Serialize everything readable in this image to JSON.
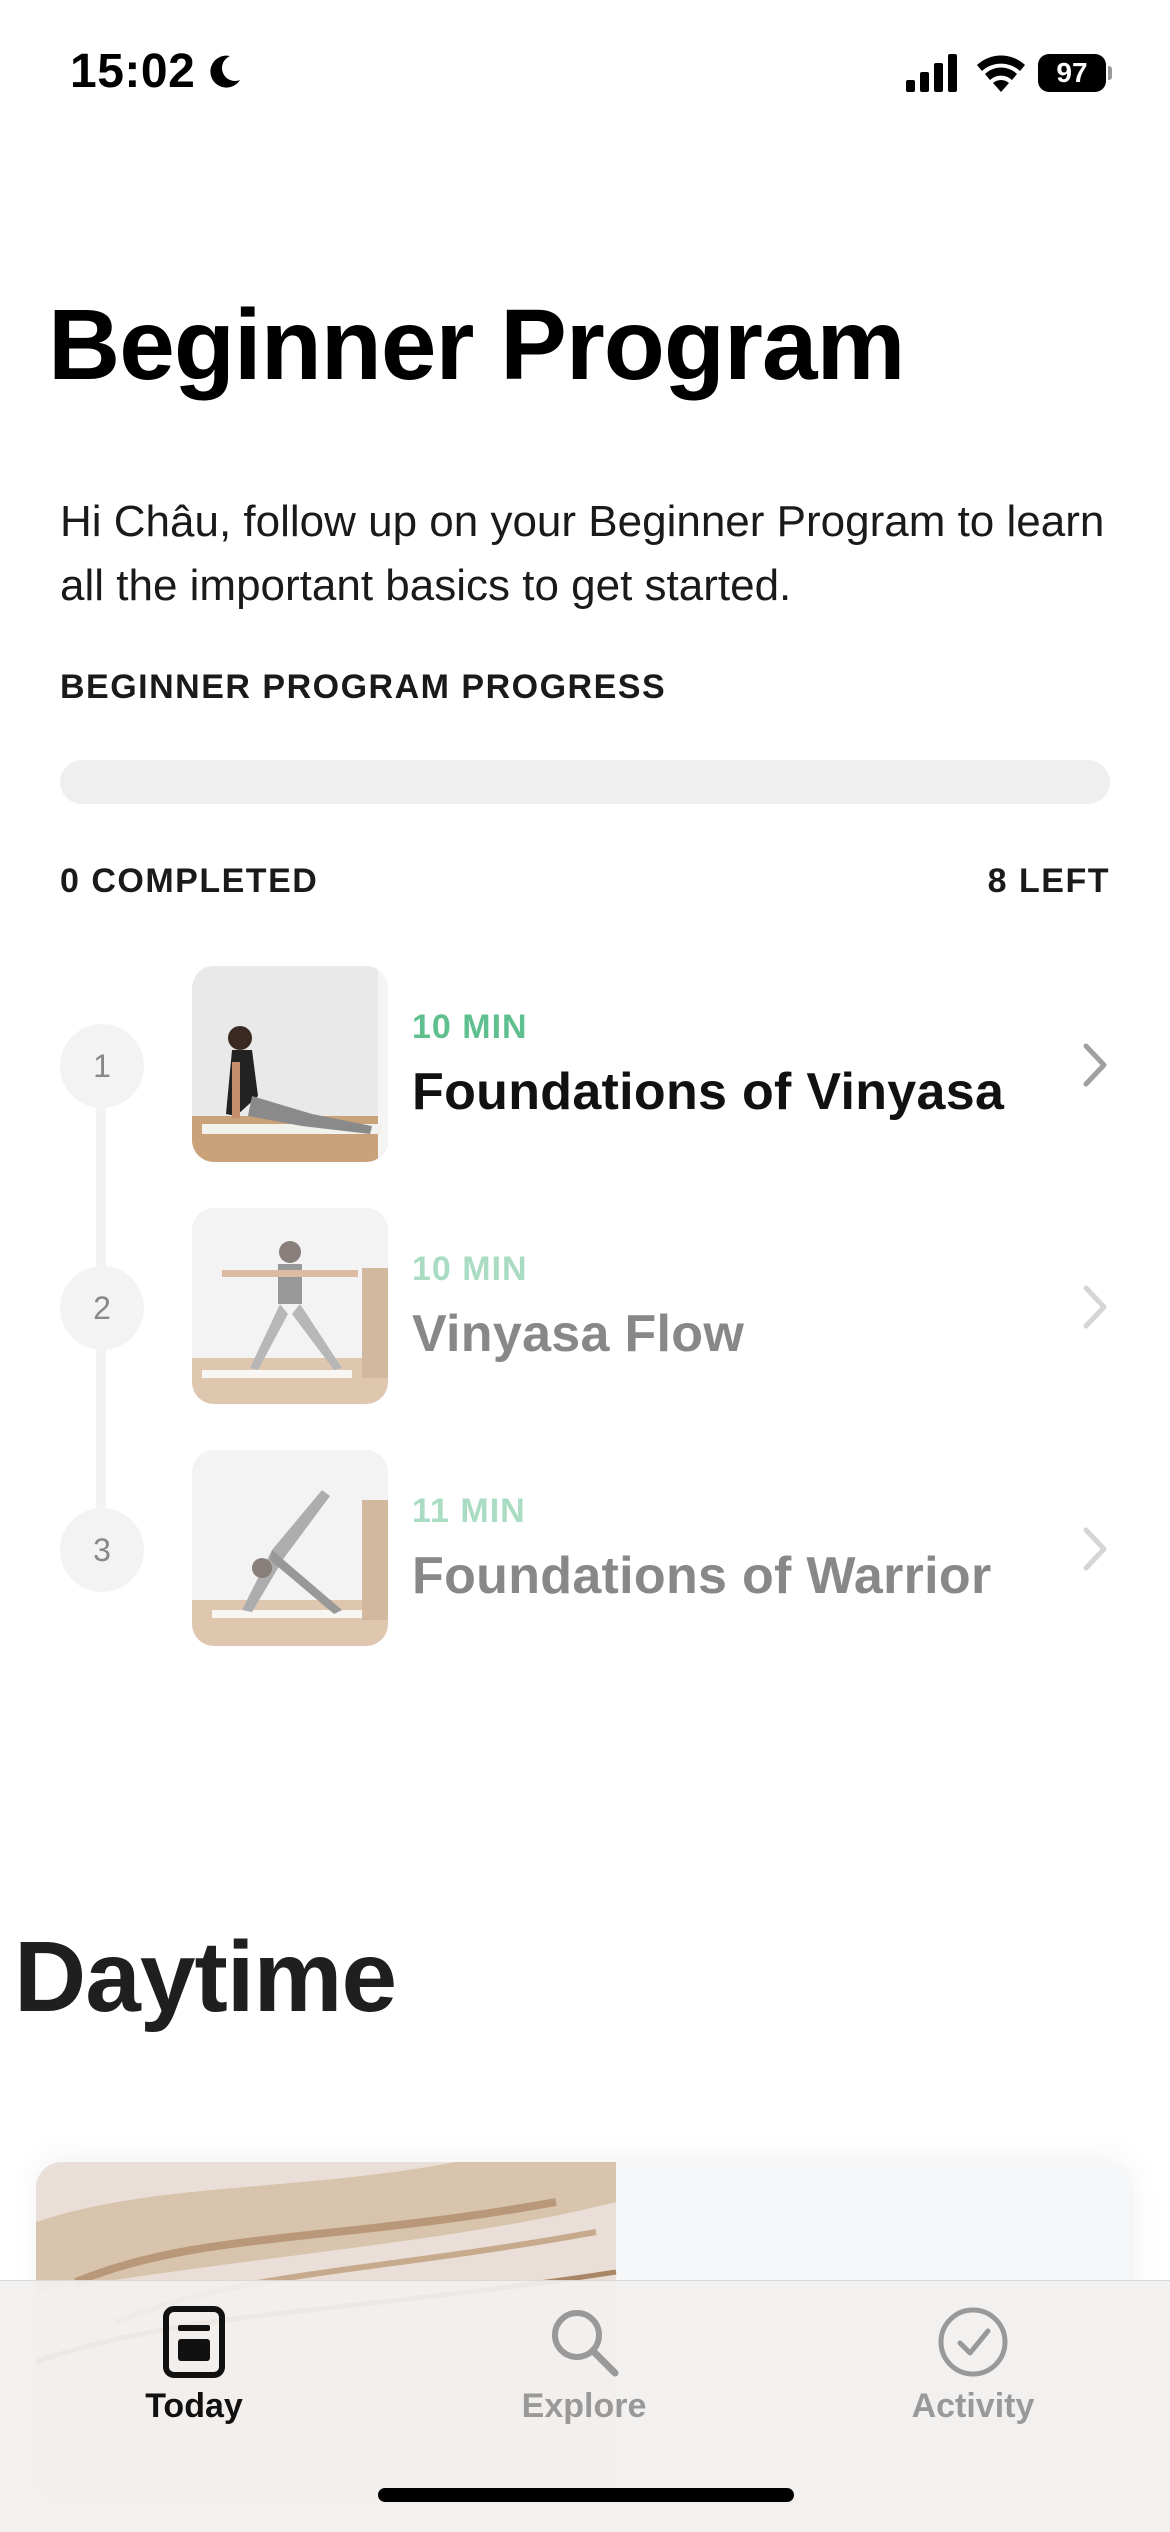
{
  "status_bar": {
    "time": "15:02",
    "battery": "97",
    "icons": [
      "moon-icon",
      "signal-icon",
      "wifi-icon",
      "battery-icon"
    ]
  },
  "header": {
    "title": "Beginner Program",
    "intro": "Hi Châu, follow up on your Beginner Program to learn all the important basics to get started."
  },
  "progress": {
    "heading": "BEGINNER PROGRAM PROGRESS",
    "completed_label": "0 COMPLETED",
    "left_label": "8 LEFT",
    "fraction": 0,
    "accent": "#6bc39a"
  },
  "program": {
    "items": [
      {
        "step": "1",
        "duration": "10 MIN",
        "title": "Foundations of Vinyasa"
      },
      {
        "step": "2",
        "duration": "10 MIN",
        "title": "Vinyasa Flow"
      },
      {
        "step": "3",
        "duration": "11 MIN",
        "title": "Foundations of Warrior"
      }
    ]
  },
  "daytime": {
    "title": "Daytime"
  },
  "tab_bar": {
    "tabs": [
      {
        "label": "Today",
        "icon": "today-icon",
        "active": true
      },
      {
        "label": "Explore",
        "icon": "search-icon",
        "active": false
      },
      {
        "label": "Activity",
        "icon": "checkmark-circle-icon",
        "active": false
      }
    ]
  },
  "colors": {
    "accent_green": "#5fbf8e",
    "accent_green_dim": "#a9dcc3",
    "text_dim": "#888888"
  }
}
